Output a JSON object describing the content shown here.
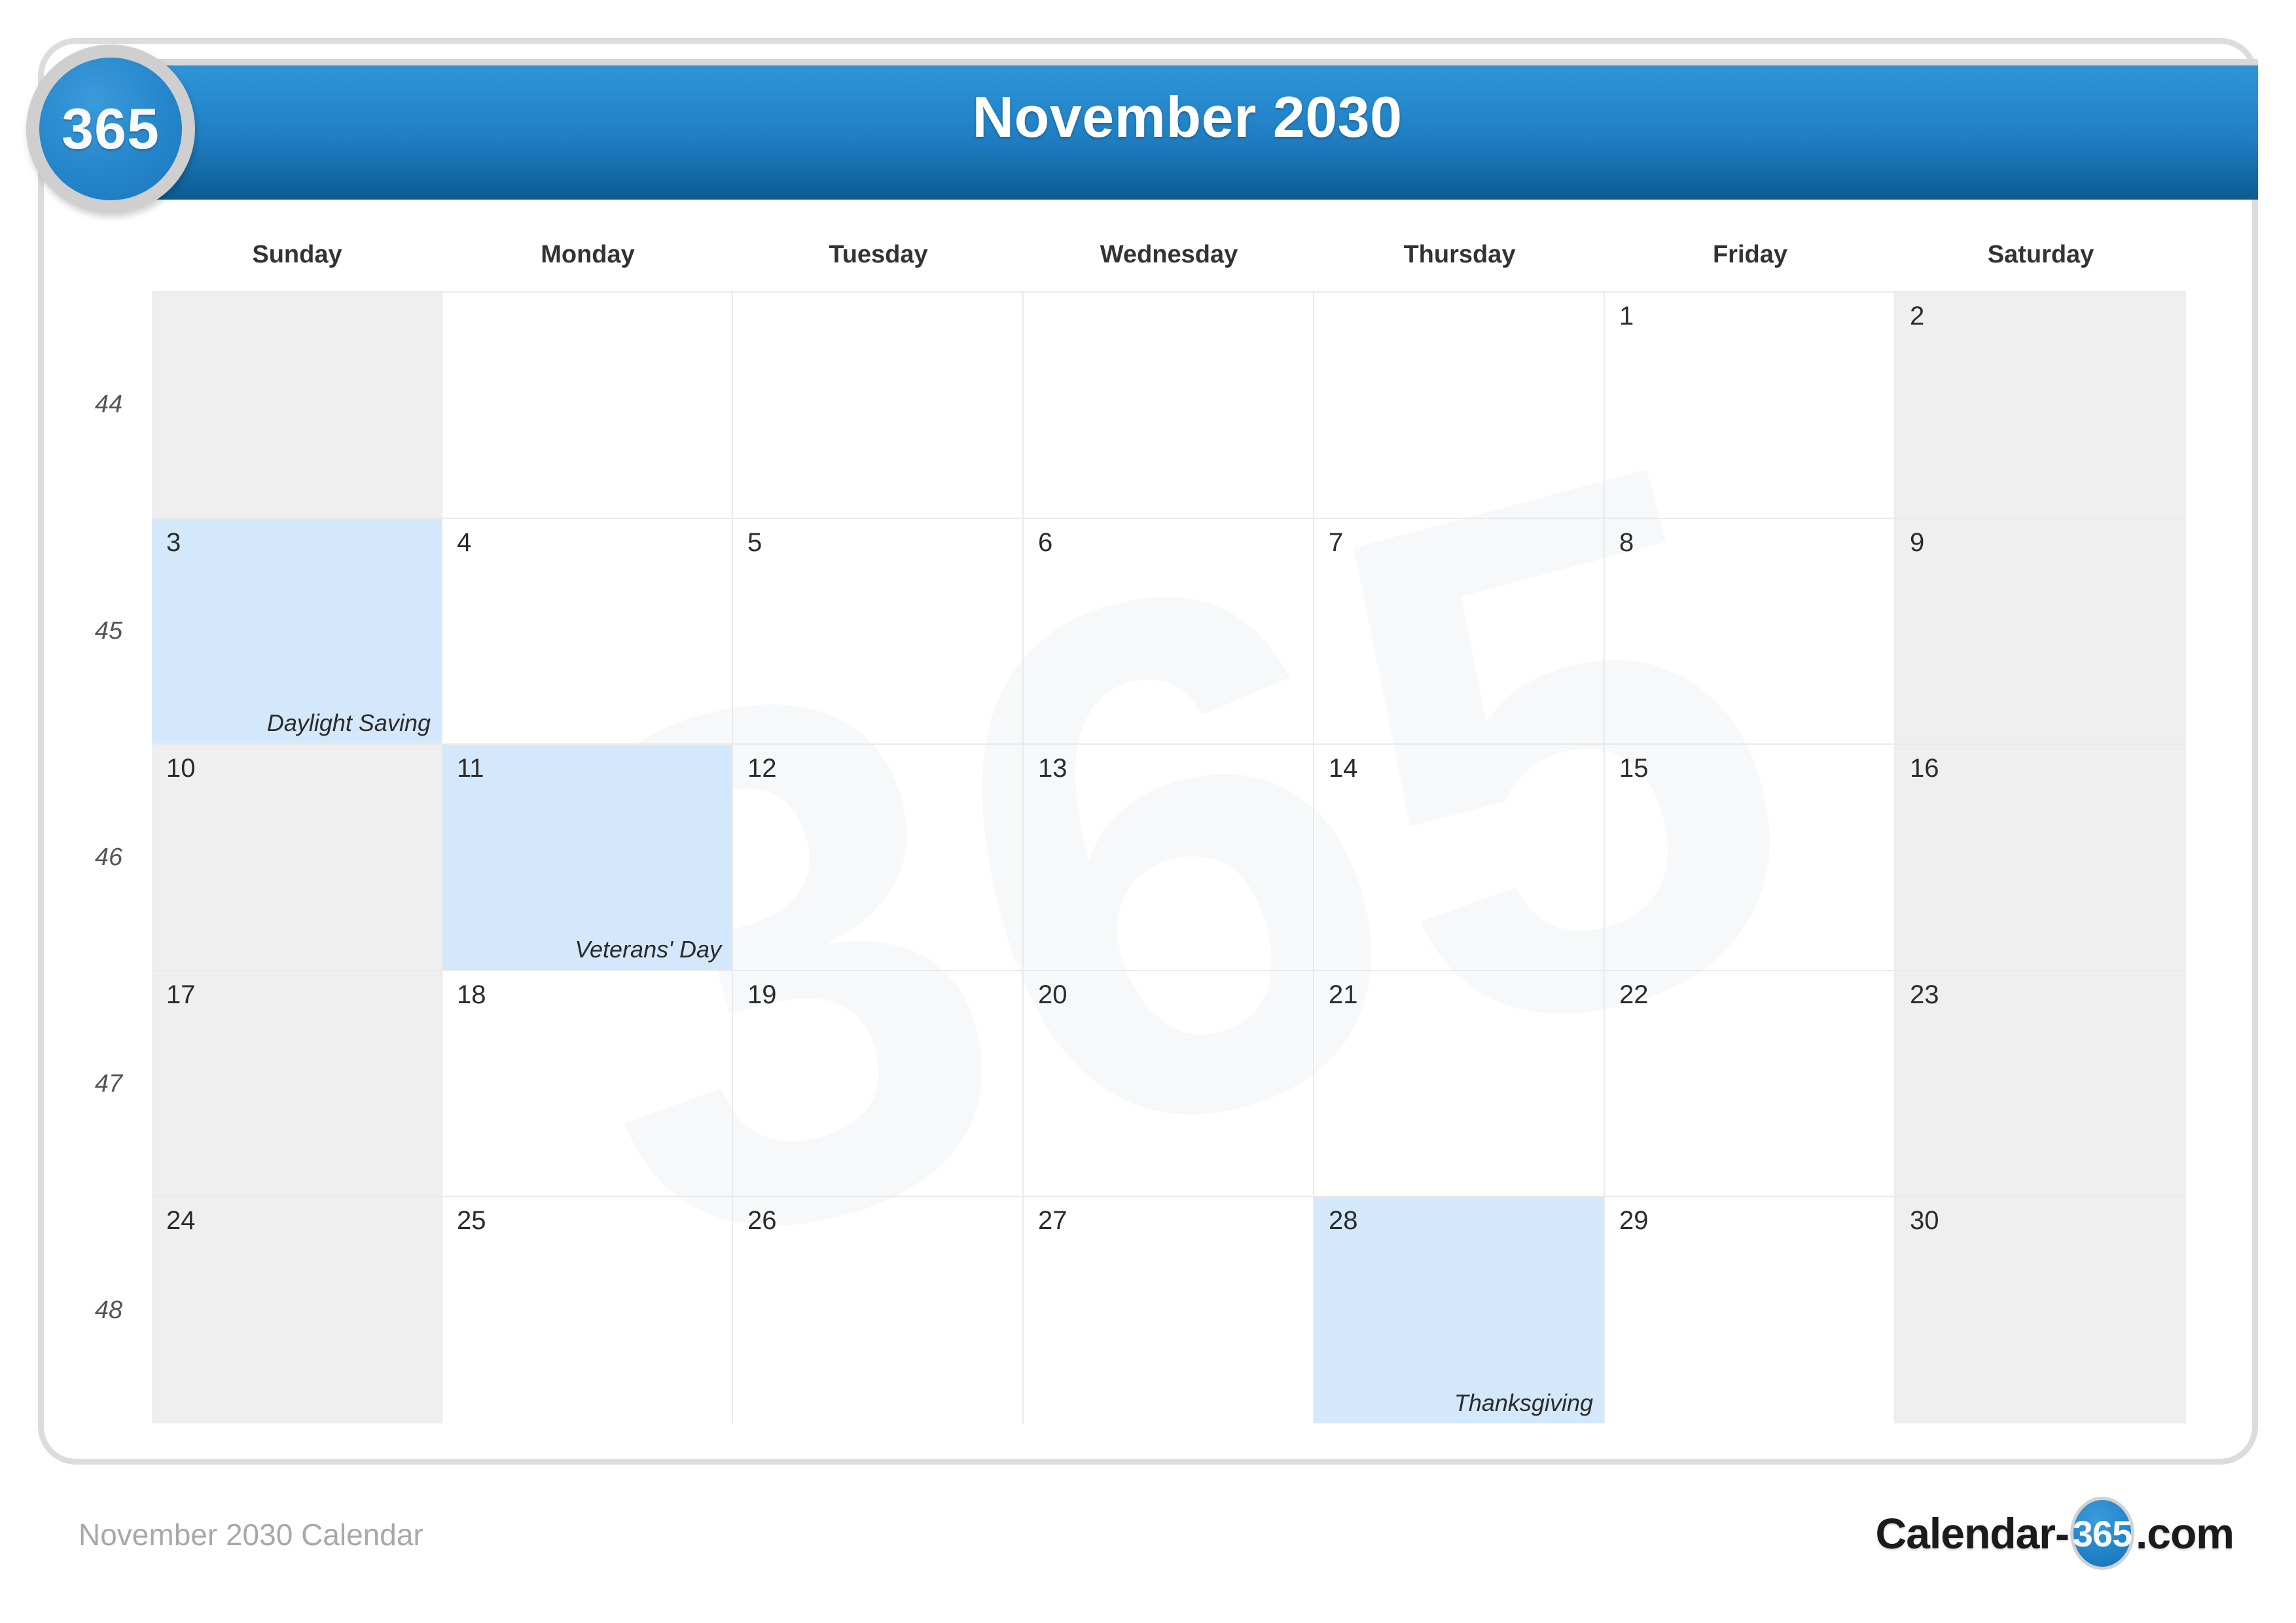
{
  "badge": {
    "label": "365"
  },
  "header": {
    "title": "November 2030"
  },
  "weekday_headers": [
    "Sunday",
    "Monday",
    "Tuesday",
    "Wednesday",
    "Thursday",
    "Friday",
    "Saturday"
  ],
  "week_numbers": [
    44,
    45,
    46,
    47,
    48
  ],
  "weeks": [
    {
      "week_number": 44,
      "days": [
        {
          "day": "",
          "holiday": "",
          "weekend": true,
          "blank": true
        },
        {
          "day": "",
          "holiday": "",
          "weekend": false,
          "blank": true
        },
        {
          "day": "",
          "holiday": "",
          "weekend": false,
          "blank": true
        },
        {
          "day": "",
          "holiday": "",
          "weekend": false,
          "blank": true
        },
        {
          "day": "",
          "holiday": "",
          "weekend": false,
          "blank": true
        },
        {
          "day": "1",
          "holiday": "",
          "weekend": false,
          "blank": false
        },
        {
          "day": "2",
          "holiday": "",
          "weekend": true,
          "blank": false
        }
      ]
    },
    {
      "week_number": 45,
      "days": [
        {
          "day": "3",
          "holiday": "Daylight Saving",
          "weekend": true,
          "blank": false
        },
        {
          "day": "4",
          "holiday": "",
          "weekend": false,
          "blank": false
        },
        {
          "day": "5",
          "holiday": "",
          "weekend": false,
          "blank": false
        },
        {
          "day": "6",
          "holiday": "",
          "weekend": false,
          "blank": false
        },
        {
          "day": "7",
          "holiday": "",
          "weekend": false,
          "blank": false
        },
        {
          "day": "8",
          "holiday": "",
          "weekend": false,
          "blank": false
        },
        {
          "day": "9",
          "holiday": "",
          "weekend": true,
          "blank": false
        }
      ]
    },
    {
      "week_number": 46,
      "days": [
        {
          "day": "10",
          "holiday": "",
          "weekend": true,
          "blank": false
        },
        {
          "day": "11",
          "holiday": "Veterans' Day",
          "weekend": false,
          "blank": false
        },
        {
          "day": "12",
          "holiday": "",
          "weekend": false,
          "blank": false
        },
        {
          "day": "13",
          "holiday": "",
          "weekend": false,
          "blank": false
        },
        {
          "day": "14",
          "holiday": "",
          "weekend": false,
          "blank": false
        },
        {
          "day": "15",
          "holiday": "",
          "weekend": false,
          "blank": false
        },
        {
          "day": "16",
          "holiday": "",
          "weekend": true,
          "blank": false
        }
      ]
    },
    {
      "week_number": 47,
      "days": [
        {
          "day": "17",
          "holiday": "",
          "weekend": true,
          "blank": false
        },
        {
          "day": "18",
          "holiday": "",
          "weekend": false,
          "blank": false
        },
        {
          "day": "19",
          "holiday": "",
          "weekend": false,
          "blank": false
        },
        {
          "day": "20",
          "holiday": "",
          "weekend": false,
          "blank": false
        },
        {
          "day": "21",
          "holiday": "",
          "weekend": false,
          "blank": false
        },
        {
          "day": "22",
          "holiday": "",
          "weekend": false,
          "blank": false
        },
        {
          "day": "23",
          "holiday": "",
          "weekend": true,
          "blank": false
        }
      ]
    },
    {
      "week_number": 48,
      "days": [
        {
          "day": "24",
          "holiday": "",
          "weekend": true,
          "blank": false
        },
        {
          "day": "25",
          "holiday": "",
          "weekend": false,
          "blank": false
        },
        {
          "day": "26",
          "holiday": "",
          "weekend": false,
          "blank": false
        },
        {
          "day": "27",
          "holiday": "",
          "weekend": false,
          "blank": false
        },
        {
          "day": "28",
          "holiday": "Thanksgiving",
          "weekend": false,
          "blank": false
        },
        {
          "day": "29",
          "holiday": "",
          "weekend": false,
          "blank": false
        },
        {
          "day": "30",
          "holiday": "",
          "weekend": true,
          "blank": false
        }
      ]
    }
  ],
  "watermark": {
    "text": "365"
  },
  "footer": {
    "caption": "November 2030 Calendar",
    "logo_left": "Calendar-",
    "logo_circle": "365",
    "logo_right": ".com"
  },
  "colors": {
    "accent_blue": "#1f7ec1",
    "badge_blue": "#2586cb",
    "holiday_bg": "#d4e8fb",
    "weekend_bg": "#ededed",
    "grid_line": "#eaeaea",
    "card_border": "#dcdcdc",
    "footer_text": "#a8a8a8"
  }
}
